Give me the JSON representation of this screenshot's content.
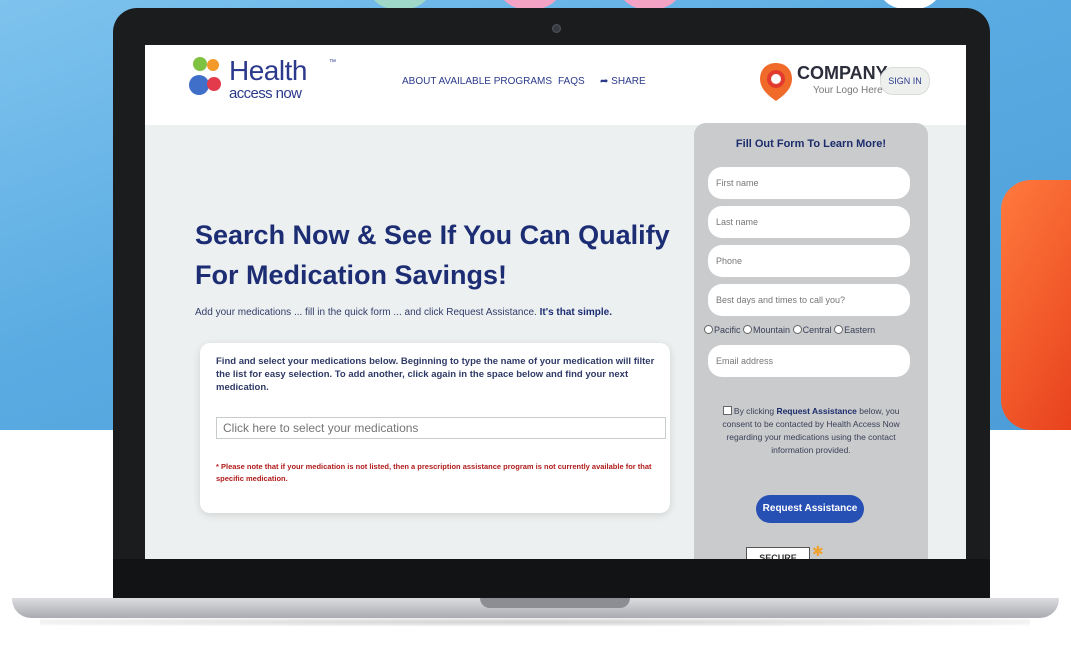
{
  "header": {
    "logo": {
      "word": "Health",
      "sub": "access now",
      "tm": "™"
    },
    "nav": [
      {
        "label": "ABOUT AVAILABLE PROGRAMS"
      },
      {
        "label": "FAQS"
      },
      {
        "label": "SHARE",
        "icon": "share-icon"
      }
    ],
    "company": {
      "name": "COMPANY",
      "tagline": "Your Logo Here"
    },
    "signin_label": "SIGN IN"
  },
  "hero": {
    "headline_line1": "Search Now & See If You Can Qualify",
    "headline_line2": "For Medication Savings!",
    "subline": "Add your medications ... fill in the quick form ... and click Request Assistance.",
    "subline_bold": "It's that simple."
  },
  "medication": {
    "instructions": "Find and select your medications below. Beginning to type the name of your medication will filter the list for easy selection. To add another, click again in the space below and find your next medication.",
    "placeholder": "Click here to select your medications",
    "note": "* Please note that if your medication is not listed, then a prescription assistance program is not currently available for that specific medication."
  },
  "form": {
    "title": "Fill Out Form To Learn More!",
    "fields": {
      "first_name": "First name",
      "last_name": "Last name",
      "phone": "Phone",
      "best_time": "Best days and times to call you?",
      "email": "Email address"
    },
    "timezones": [
      "Pacific",
      "Mountain",
      "Central",
      "Eastern"
    ],
    "consent_pre": "By clicking",
    "consent_bold": "Request Assistance",
    "consent_post": "below, you consent to be contacted by Health Access Now regarding your medications using the contact information provided.",
    "submit_label": "Request Assistance",
    "secure_label": "SECURE"
  },
  "colors": {
    "brand_navy": "#1c2d74",
    "button_blue": "#2750b5",
    "note_red": "#b11b1b",
    "company_orange": "#f06a2a"
  }
}
